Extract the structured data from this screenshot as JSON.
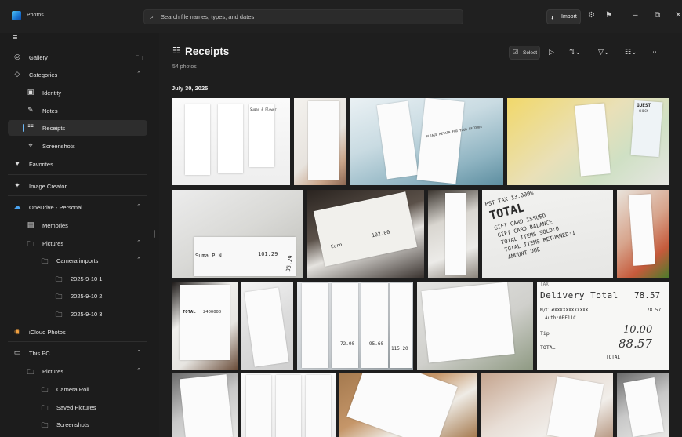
{
  "app": {
    "title": "Photos",
    "search_placeholder": "Search file names, types, and dates",
    "import_label": "Import"
  },
  "sidebar": {
    "items": [
      {
        "label": "Gallery"
      },
      {
        "label": "Categories"
      },
      {
        "label": "Identity"
      },
      {
        "label": "Notes"
      },
      {
        "label": "Receipts"
      },
      {
        "label": "Screenshots"
      },
      {
        "label": "Favorites"
      },
      {
        "label": "Image Creator"
      },
      {
        "label": "OneDrive - Personal"
      },
      {
        "label": "Memories"
      },
      {
        "label": "Pictures"
      },
      {
        "label": "Camera imports"
      },
      {
        "label": "2025-9-10 1"
      },
      {
        "label": "2025-9-10 2"
      },
      {
        "label": "2025-9-10 3"
      },
      {
        "label": "iCloud Photos"
      },
      {
        "label": "This PC"
      },
      {
        "label": "Pictures"
      },
      {
        "label": "Camera Roll"
      },
      {
        "label": "Saved Pictures"
      },
      {
        "label": "Screenshots"
      }
    ],
    "selected": "Receipts"
  },
  "main": {
    "title": "Receipts",
    "count": "54 photos",
    "select_label": "Select",
    "date_header": "July 30, 2025"
  },
  "photo_text": {
    "receipt_brand": "Sugar & Flower",
    "pile_text": "PLEASE RETAIN FOR YOUR RECORDS",
    "total_line1": "HST TAX 13.000%",
    "total_line2": "TOTAL",
    "total_line3": "GIFT CARD ISSUED",
    "total_line4": "GIFT CARD BALANCE",
    "total_line5": "TOTAL ITEMS SOLD:0",
    "total_line6": "TOTAL ITEMS RETURNED:1",
    "total_line7": "AMOUNT DUE",
    "desk_amount": "102.00",
    "desk_euro": "Euro",
    "pile_suma": "Suma PLN",
    "pile_amount1": "101.29",
    "pile_amount2": "35.29",
    "white_total": "TOTAL",
    "white_amount": "2400000",
    "delivery_title": "Delivery Total",
    "delivery_amount": "78.57",
    "delivery_mc": "M/C #XXXXXXXXXXXX",
    "delivery_auth": "Auth:0BF11C",
    "delivery_tip_label": "Tip",
    "delivery_tip": "10.00",
    "delivery_total_label": "TOTAL",
    "delivery_total": "88.57",
    "delivery_bottom_label": "TOTAL",
    "stack_amount1": "72.00",
    "stack_amount2": "95.60",
    "stack_amount3": "115.20",
    "guest_label": "GUEST",
    "guest_check": "CHECK",
    "stub_tax": "TAX"
  },
  "colors": {
    "accent": "#6cb8f6",
    "background": "#1c1c1c",
    "selected_bg": "#2d2d2d"
  }
}
